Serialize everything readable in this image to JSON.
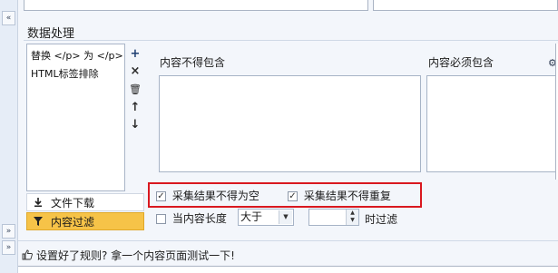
{
  "left_strip": {
    "up_glyph": "«",
    "down_glyph_1": "»",
    "down_glyph_2": "»"
  },
  "section": {
    "title": "数据处理"
  },
  "rules": {
    "items": [
      {
        "label": "替换 </p> 为 </p>"
      },
      {
        "label": "HTML标签排除"
      }
    ],
    "toolbar": {
      "add": "+",
      "delete": "×",
      "trash": "🗑",
      "up": "↑",
      "down": "↓"
    }
  },
  "menu": {
    "download": {
      "label": "文件下载",
      "icon": "download-icon"
    },
    "filter": {
      "label": "内容过滤",
      "icon": "filter-icon",
      "active_color": "#f6c348"
    }
  },
  "fields": {
    "exclude_label": "内容不得包含",
    "exclude_value": "",
    "require_label": "内容必须包含",
    "require_value": ""
  },
  "options": {
    "not_empty": {
      "label": "采集结果不得为空",
      "checked": true
    },
    "no_duplicate": {
      "label": "采集结果不得重复",
      "checked": true
    },
    "length": {
      "label": "当内容长度",
      "checked": false,
      "operator": "大于",
      "value": "",
      "suffix": "时过滤"
    }
  },
  "hint": {
    "text": "设置好了规则? 拿一个内容页面测试一下!"
  },
  "colors": {
    "highlight_border": "#d9181f",
    "active_menu": "#f6c348"
  }
}
